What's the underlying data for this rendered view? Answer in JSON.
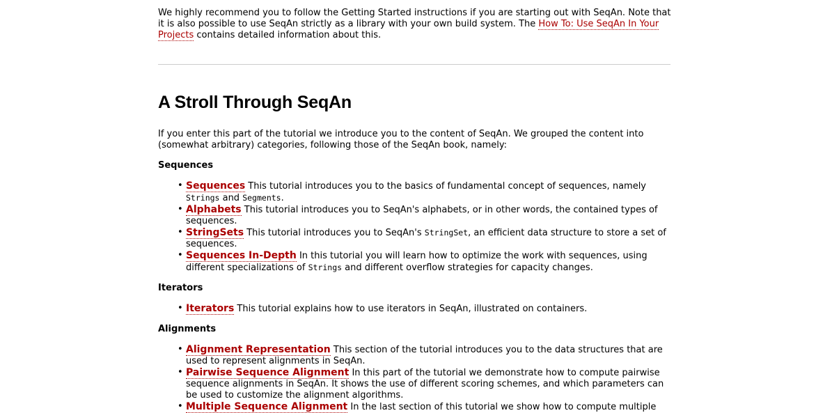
{
  "intro": {
    "text1": "We highly recommend you to follow the Getting Started instructions if you are starting out with SeqAn. Note that it is also possible to use SeqAn strictly as a library with your own build system. The ",
    "link": "How To: Use SeqAn In Your Projects",
    "text2": " contains detailed information about this."
  },
  "heading": "A Stroll Through SeqAn",
  "lead": "If you enter this part of the tutorial we introduce you to the content of SeqAn. We grouped the content into (somewhat arbitrary) categories, following those of the SeqAn book, namely:",
  "sections": {
    "sequences": {
      "title": "Sequences",
      "items": {
        "seq": {
          "link": "Sequences",
          "t1": " This tutorial introduces you to the basics of fundamental concept of sequences, namely ",
          "c1": "Strings",
          "t2": " and ",
          "c2": "Segments",
          "t3": "."
        },
        "alph": {
          "link": "Alphabets",
          "t1": " This tutorial introduces you to SeqAn's alphabets, or in other words, the contained types of sequences."
        },
        "sets": {
          "link": "StringSets",
          "t1": " This tutorial introduces you to SeqAn's ",
          "c1": "StringSet",
          "t2": ", an efficient data structure to store a set of sequences."
        },
        "depth": {
          "link": "Sequences In-Depth",
          "t1": " In this tutorial you will learn how to optimize the work with sequences, using different specializations of ",
          "c1": "Strings",
          "t2": " and different overflow strategies for capacity changes."
        }
      }
    },
    "iterators": {
      "title": "Iterators",
      "items": {
        "it": {
          "link": "Iterators",
          "t1": " This tutorial explains how to use iterators in SeqAn, illustrated on containers."
        }
      }
    },
    "alignments": {
      "title": "Alignments",
      "items": {
        "rep": {
          "link": "Alignment Representation",
          "t1": " This section of the tutorial introduces you to the data structures that are used to represent alignments in SeqAn."
        },
        "pair": {
          "link": "Pairwise Sequence Alignment",
          "t1": " In this part of the tutorial we demonstrate how to compute pairwise sequence alignments in SeqAn. It shows the use of different scoring schemes, and which parameters can be used to customize the alignment algorithms."
        },
        "msa": {
          "link": "Multiple Sequence Alignment",
          "t1": " In the last section of this tutorial we show how to compute multiple"
        }
      }
    }
  },
  "bullet": "•",
  "colors": {
    "link": "#aa0000",
    "rule": "#cccccc"
  }
}
